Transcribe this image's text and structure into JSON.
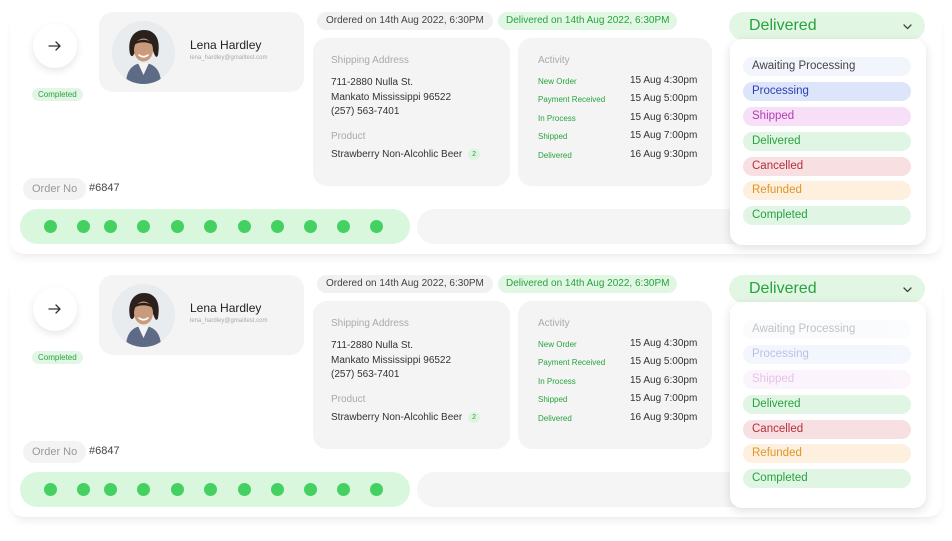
{
  "orders": [
    {
      "status_badge": "Completed",
      "customer": {
        "name": "Lena Hardley",
        "email": "lena_hardley@gmailtest.com"
      },
      "ordered_on": "Ordered on 14th Aug 2022, 6:30PM",
      "delivered_on": "Delivered on 14th Aug 2022, 6:30PM",
      "shipping": {
        "label": "Shipping Address",
        "line1": "711-2880 Nulla St.",
        "line2": "Mankato Mississippi 96522",
        "phone": "(257) 563-7401",
        "product_label": "Product",
        "product": "Strawberry Non-Alcohlic Beer",
        "qty": "2"
      },
      "activity": {
        "label": "Activity",
        "events": [
          {
            "label": "New Order",
            "time": "15 Aug 4:30pm"
          },
          {
            "label": "Payment Received",
            "time": "15 Aug 5:00pm"
          },
          {
            "label": "In Process",
            "time": "15 Aug 6:30pm"
          },
          {
            "label": "Shipped",
            "time": "15 Aug 7:00pm"
          },
          {
            "label": "Delivered",
            "time": "16 Aug 9:30pm"
          }
        ]
      },
      "order_no_label": "Order No",
      "order_no": "#6847",
      "progress_dots": 11,
      "status_select": "Delivered",
      "options": [
        "Awaiting Processing",
        "Processing",
        "Shipped",
        "Delivered",
        "Cancelled",
        "Refunded",
        "Completed"
      ]
    },
    {
      "status_badge": "Completed",
      "customer": {
        "name": "Lena Hardley",
        "email": "lena_hardley@gmailtest.com"
      },
      "ordered_on": "Ordered on 14th Aug 2022, 6:30PM",
      "delivered_on": "Delivered on 14th Aug 2022, 6:30PM",
      "shipping": {
        "label": "Shipping Address",
        "line1": "711-2880 Nulla St.",
        "line2": "Mankato Mississippi 96522",
        "phone": "(257) 563-7401",
        "product_label": "Product",
        "product": "Strawberry Non-Alcohlic Beer",
        "qty": "2"
      },
      "activity": {
        "label": "Activity",
        "events": [
          {
            "label": "New Order",
            "time": "15 Aug 4:30pm"
          },
          {
            "label": "Payment Received",
            "time": "15 Aug 5:00pm"
          },
          {
            "label": "In Process",
            "time": "15 Aug 6:30pm"
          },
          {
            "label": "Shipped",
            "time": "15 Aug 7:00pm"
          },
          {
            "label": "Delivered",
            "time": "16 Aug 9:30pm"
          }
        ]
      },
      "order_no_label": "Order No",
      "order_no": "#6847",
      "progress_dots": 11,
      "status_select": "Delivered",
      "options": [
        "Awaiting Processing",
        "Processing",
        "Shipped",
        "Delivered",
        "Cancelled",
        "Refunded",
        "Completed"
      ],
      "disabled_options": [
        "Awaiting Processing",
        "Processing",
        "Shipped"
      ]
    }
  ],
  "colors": {
    "accent_green": "#27a33e",
    "dot_green": "#45d162",
    "pill_green": "#e2f6e4"
  },
  "icons": {
    "arrow": "arrow-right-icon",
    "chevron": "chevron-down-icon"
  }
}
